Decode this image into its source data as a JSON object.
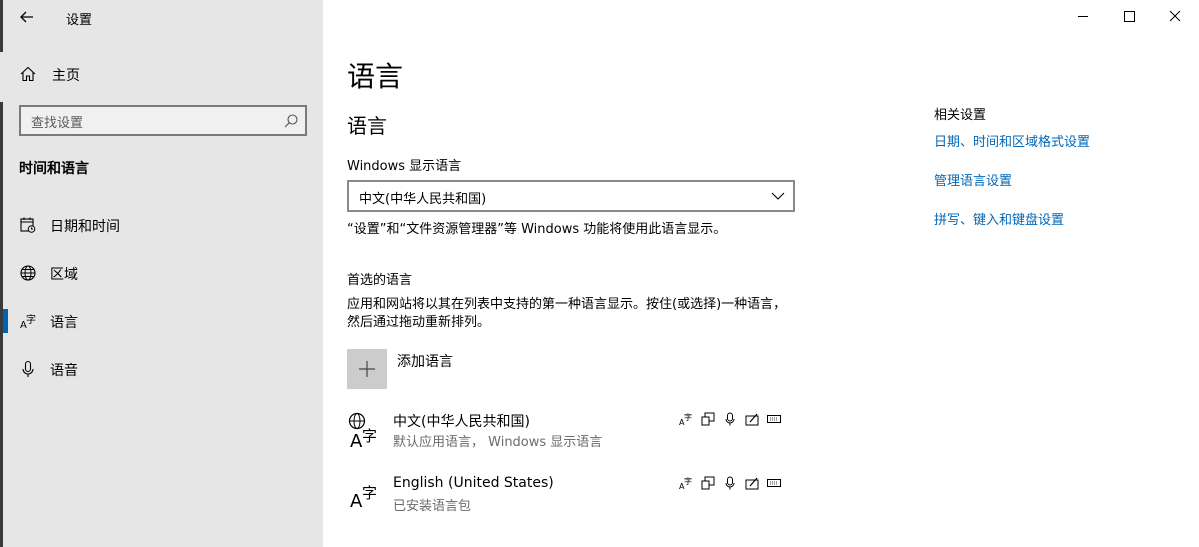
{
  "window": {
    "title": "设置",
    "accent_color": "#0063b1",
    "link_color": "#0067b8"
  },
  "sidebar": {
    "home_label": "主页",
    "search_placeholder": "查找设置",
    "section_title": "时间和语言",
    "items": [
      {
        "label": "日期和时间",
        "icon": "calendar-clock-icon"
      },
      {
        "label": "区域",
        "icon": "globe-icon"
      },
      {
        "label": "语言",
        "icon": "language-icon",
        "selected": true
      },
      {
        "label": "语音",
        "icon": "microphone-icon"
      }
    ]
  },
  "main": {
    "page_title": "语言",
    "section_title": "语言",
    "display_language_label": "Windows 显示语言",
    "display_language_value": "中文(中华人民共和国)",
    "display_language_note": "“设置”和“文件资源管理器”等 Windows 功能将使用此语言显示。",
    "preferred_title": "首选的语言",
    "preferred_desc": "应用和网站将以其在列表中支持的第一种语言显示。按住(或选择)一种语言，然后通过拖动重新排列。",
    "add_language_label": "添加语言",
    "languages": [
      {
        "name": "中文(中华人民共和国)",
        "sub": "默认应用语言， Windows 显示语言"
      },
      {
        "name": "English (United States)",
        "sub": "已安装语言包"
      }
    ]
  },
  "related": {
    "title": "相关设置",
    "links": [
      "日期、时间和区域格式设置",
      "管理语言设置",
      "拼写、键入和键盘设置"
    ]
  }
}
